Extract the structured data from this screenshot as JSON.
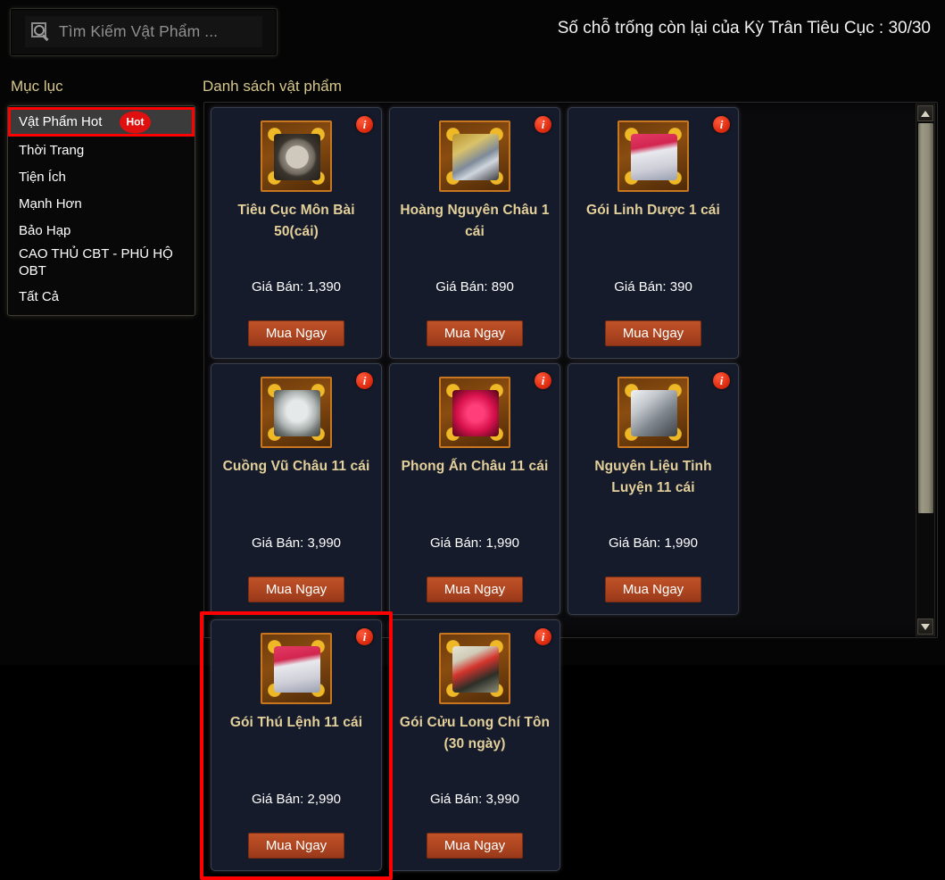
{
  "header": {
    "slot_info": "Số chỗ trống còn lại của Kỳ Trân Tiêu Cục : 30/30"
  },
  "search": {
    "placeholder": "Tìm Kiếm Vật Phẩm ...",
    "value": "",
    "icon": "search-icon"
  },
  "sidebar": {
    "title": "Mục lục",
    "items": [
      {
        "label": "Vật Phẩm Hot",
        "badge": "Hot",
        "selected": true
      },
      {
        "label": "Thời Trang",
        "badge": "",
        "selected": false
      },
      {
        "label": "Tiện Ích",
        "badge": "",
        "selected": false
      },
      {
        "label": "Mạnh Hơn",
        "badge": "",
        "selected": false
      },
      {
        "label": "Bảo Hạp",
        "badge": "",
        "selected": false
      },
      {
        "label": "CAO THỦ CBT - PHÚ HỘ OBT",
        "badge": "",
        "selected": false
      },
      {
        "label": "Tất Cả",
        "badge": "",
        "selected": false
      }
    ]
  },
  "main": {
    "title": "Danh sách vật phẩm",
    "items": [
      {
        "name": "Tiêu Cục Môn Bài 50(cái)",
        "price": "Giá Bán: 1,390",
        "buy_label": "Mua Ngay",
        "icon": "wheel-token-icon",
        "highlighted": false
      },
      {
        "name": "Hoàng Nguyên Châu 1 cái",
        "price": "Giá Bán: 890",
        "buy_label": "Mua Ngay",
        "icon": "golden-orb-icon",
        "highlighted": false
      },
      {
        "name": "Gói Linh Dược 1 cái",
        "price": "Giá Bán: 390",
        "buy_label": "Mua Ngay",
        "icon": "red-potion-pack-icon",
        "highlighted": false
      },
      {
        "name": "Cuồng Vũ Châu 11 cái",
        "price": "Giá Bán: 3,990",
        "buy_label": "Mua Ngay",
        "icon": "wind-rune-icon",
        "highlighted": false
      },
      {
        "name": "Phong Ấn Châu 11 cái",
        "price": "Giá Bán: 1,990",
        "buy_label": "Mua Ngay",
        "icon": "seal-orb-icon",
        "highlighted": false
      },
      {
        "name": "Nguyên Liệu Tinh Luyện 11 cái",
        "price": "Giá Bán: 1,990",
        "buy_label": "Mua Ngay",
        "icon": "silver-ore-icon",
        "highlighted": false
      },
      {
        "name": "Gói Thú Lệnh 11 cái",
        "price": "Giá Bán: 2,990",
        "buy_label": "Mua Ngay",
        "icon": "red-potion-pack-icon",
        "highlighted": true
      },
      {
        "name": "Gói Cửu Long Chí Tôn (30 ngày)",
        "price": "Giá Bán: 3,990",
        "buy_label": "Mua Ngay",
        "icon": "dragon-mask-icon",
        "highlighted": false
      }
    ]
  },
  "scrollbar": {
    "up_icon": "chevron-up-icon",
    "down_icon": "chevron-down-icon",
    "thumb_position": "top",
    "thumb_fraction": 0.79
  },
  "colors": {
    "accent_gold": "#e3d09a",
    "buy_button": "#ad4520",
    "highlight": "#ff0000",
    "badge_red": "#e01010",
    "card_bg": "#161b2b"
  }
}
